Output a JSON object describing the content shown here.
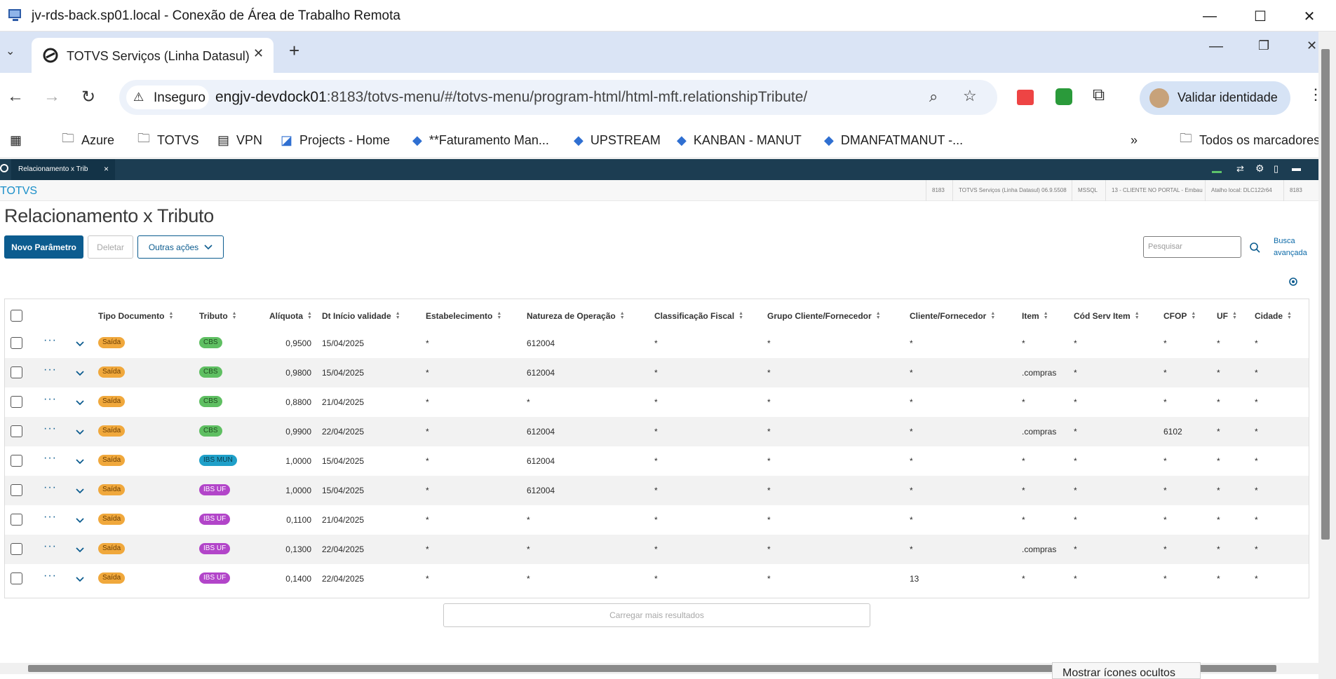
{
  "rdp": {
    "title": "jv-rds-back.sp01.local - Conexão de Área de Trabalho Remota"
  },
  "browser": {
    "tab_title": "TOTVS Serviços (Linha Datasul)",
    "new_tab_glyph": "+",
    "insecure_label": "Inseguro",
    "url_host": "engjv-devdock01",
    "url_rest": ":8183/totvs-menu/#/totvs-menu/program-html/html-mft.relationshipTribute/",
    "profile_button": "Validar identidade",
    "bookmarks": [
      {
        "label": "Azure",
        "icon": "folder-icon"
      },
      {
        "label": "TOTVS",
        "icon": "folder-icon"
      },
      {
        "label": "VPN",
        "icon": "page-icon"
      },
      {
        "label": "Projects - Home",
        "icon": "devops-icon"
      },
      {
        "label": "**Faturamento Man...",
        "icon": "diamond-icon"
      },
      {
        "label": "UPSTREAM",
        "icon": "diamond-icon"
      },
      {
        "label": "KANBAN - MANUT",
        "icon": "diamond-icon"
      },
      {
        "label": "DMANFATMANUT -...",
        "icon": "diamond-icon"
      }
    ],
    "all_bookmarks": "Todos os marcadores"
  },
  "app": {
    "tab_label": "Relacionamento x Trib",
    "tab_close": "×",
    "brand": "TOTVS",
    "info": [
      "8183",
      "TOTVS Serviços (Linha Datasul) 06.9.5508",
      "MSSQL",
      "13 - CLIENTE NO PORTAL - Embau",
      "Atalho local: DLC122r64",
      "8183"
    ],
    "page_title": "Relacionamento x Tributo",
    "btn_novo": "Novo Parâmetro",
    "btn_deletar": "Deletar",
    "btn_outras": "Outras ações",
    "search_placeholder": "Pesquisar",
    "busca_avancada": "Busca avançada",
    "load_more": "Carregar mais resultados"
  },
  "table": {
    "headers": [
      "Tipo Documento",
      "Tributo",
      "Alíquota",
      "Dt Início validade",
      "Estabelecimento",
      "Natureza de Operação",
      "Classificação Fiscal",
      "Grupo Cliente/Fornecedor",
      "Cliente/Fornecedor",
      "Item",
      "Cód Serv Item",
      "CFOP",
      "UF",
      "Cidade"
    ],
    "rows": [
      {
        "tipo": "Saída",
        "tributo": "CBS",
        "tributo_kind": "cbs",
        "aliquota": "0,9500",
        "dt": "15/04/2025",
        "estab": "*",
        "natureza": "612004",
        "classif": "*",
        "grupo": "*",
        "cliente": "*",
        "item": "*",
        "codserv": "*",
        "cfop": "*",
        "uf": "*",
        "cidade": "*"
      },
      {
        "tipo": "Saída",
        "tributo": "CBS",
        "tributo_kind": "cbs",
        "aliquota": "0,9800",
        "dt": "15/04/2025",
        "estab": "*",
        "natureza": "612004",
        "classif": "*",
        "grupo": "*",
        "cliente": "*",
        "item": ".compras",
        "codserv": "*",
        "cfop": "*",
        "uf": "*",
        "cidade": "*"
      },
      {
        "tipo": "Saída",
        "tributo": "CBS",
        "tributo_kind": "cbs",
        "aliquota": "0,8800",
        "dt": "21/04/2025",
        "estab": "*",
        "natureza": "*",
        "classif": "*",
        "grupo": "*",
        "cliente": "*",
        "item": "*",
        "codserv": "*",
        "cfop": "*",
        "uf": "*",
        "cidade": "*"
      },
      {
        "tipo": "Saída",
        "tributo": "CBS",
        "tributo_kind": "cbs",
        "aliquota": "0,9900",
        "dt": "22/04/2025",
        "estab": "*",
        "natureza": "612004",
        "classif": "*",
        "grupo": "*",
        "cliente": "*",
        "item": ".compras",
        "codserv": "*",
        "cfop": "6102",
        "uf": "*",
        "cidade": "*"
      },
      {
        "tipo": "Saída",
        "tributo": "IBS MUN",
        "tributo_kind": "ibsmun",
        "aliquota": "1,0000",
        "dt": "15/04/2025",
        "estab": "*",
        "natureza": "612004",
        "classif": "*",
        "grupo": "*",
        "cliente": "*",
        "item": "*",
        "codserv": "*",
        "cfop": "*",
        "uf": "*",
        "cidade": "*"
      },
      {
        "tipo": "Saída",
        "tributo": "IBS UF",
        "tributo_kind": "ibsuf",
        "aliquota": "1,0000",
        "dt": "15/04/2025",
        "estab": "*",
        "natureza": "612004",
        "classif": "*",
        "grupo": "*",
        "cliente": "*",
        "item": "*",
        "codserv": "*",
        "cfop": "*",
        "uf": "*",
        "cidade": "*"
      },
      {
        "tipo": "Saída",
        "tributo": "IBS UF",
        "tributo_kind": "ibsuf",
        "aliquota": "0,1100",
        "dt": "21/04/2025",
        "estab": "*",
        "natureza": "*",
        "classif": "*",
        "grupo": "*",
        "cliente": "*",
        "item": "*",
        "codserv": "*",
        "cfop": "*",
        "uf": "*",
        "cidade": "*"
      },
      {
        "tipo": "Saída",
        "tributo": "IBS UF",
        "tributo_kind": "ibsuf",
        "aliquota": "0,1300",
        "dt": "22/04/2025",
        "estab": "*",
        "natureza": "*",
        "classif": "*",
        "grupo": "*",
        "cliente": "*",
        "item": ".compras",
        "codserv": "*",
        "cfop": "*",
        "uf": "*",
        "cidade": "*"
      },
      {
        "tipo": "Saída",
        "tributo": "IBS UF",
        "tributo_kind": "ibsuf",
        "aliquota": "0,1400",
        "dt": "22/04/2025",
        "estab": "*",
        "natureza": "*",
        "classif": "*",
        "grupo": "*",
        "cliente": "13",
        "item": "*",
        "codserv": "*",
        "cfop": "*",
        "uf": "*",
        "cidade": "*"
      }
    ]
  },
  "system": {
    "tooltip": "Mostrar ícones ocultos"
  },
  "colors": {
    "primary": "#0c5c8f",
    "appbar": "#1c3d52",
    "tag_saida": "#f0a83c",
    "tag_cbs": "#5fbf62",
    "tag_ibsmun": "#1fa0c9",
    "tag_ibsuf": "#b245c9"
  }
}
